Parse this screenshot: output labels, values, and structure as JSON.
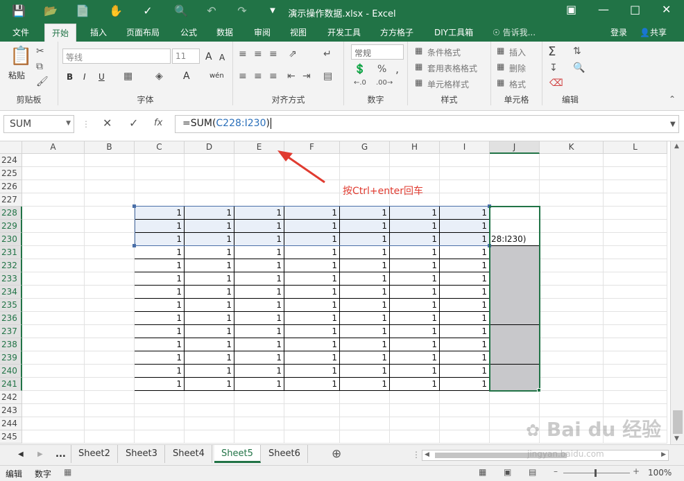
{
  "window": {
    "title": "演示操作数据.xlsx - Excel"
  },
  "menu": {
    "items": [
      "文件",
      "开始",
      "插入",
      "页面布局",
      "公式",
      "数据",
      "审阅",
      "视图",
      "开发工具",
      "方方格子",
      "DIY工具箱"
    ],
    "tell_me": "告诉我...",
    "login": "登录",
    "share": "共享"
  },
  "ribbon": {
    "clipboard": {
      "label": "剪贴板",
      "paste": "粘贴"
    },
    "font": {
      "label": "字体",
      "font_name": "等线",
      "font_size": "11",
      "bold": "B",
      "italic": "I",
      "underline": "U",
      "grow": "A",
      "shrink": "A",
      "color": "A",
      "phonetic": "wén"
    },
    "alignment": {
      "label": "对齐方式"
    },
    "number": {
      "label": "数字",
      "format": "常规",
      "percent": "%",
      "comma": ","
    },
    "styles": {
      "label": "样式",
      "conditional": "条件格式",
      "table": "套用表格格式",
      "cell_styles": "单元格样式"
    },
    "cells": {
      "label": "单元格",
      "insert": "插入",
      "delete": "删除",
      "format": "格式"
    },
    "editing": {
      "label": "编辑",
      "sum": "Σ"
    }
  },
  "formula_bar": {
    "name_box": "SUM",
    "fx": "fx",
    "prefix": "=SUM(",
    "ref": "C228:I230",
    "suffix": ")"
  },
  "columns": [
    "A",
    "B",
    "C",
    "D",
    "E",
    "F",
    "G",
    "H",
    "I",
    "J",
    "K",
    "L"
  ],
  "rows": [
    "224",
    "225",
    "226",
    "227",
    "228",
    "229",
    "230",
    "231",
    "232",
    "233",
    "234",
    "235",
    "236",
    "237",
    "238",
    "239",
    "240",
    "241",
    "242",
    "243",
    "244",
    "245"
  ],
  "cell_value": "1",
  "active_cell_text": "28:I230)",
  "annotation": "按Ctrl+enter回车",
  "sheets": {
    "ellipsis": "...",
    "tabs": [
      "Sheet2",
      "Sheet3",
      "Sheet4",
      "Sheet5",
      "Sheet6"
    ],
    "active": "Sheet5"
  },
  "status": {
    "mode": "编辑",
    "numeric": "数字",
    "zoom": "100%"
  },
  "watermark": "Baidu经验 jingyan.baidu.com"
}
